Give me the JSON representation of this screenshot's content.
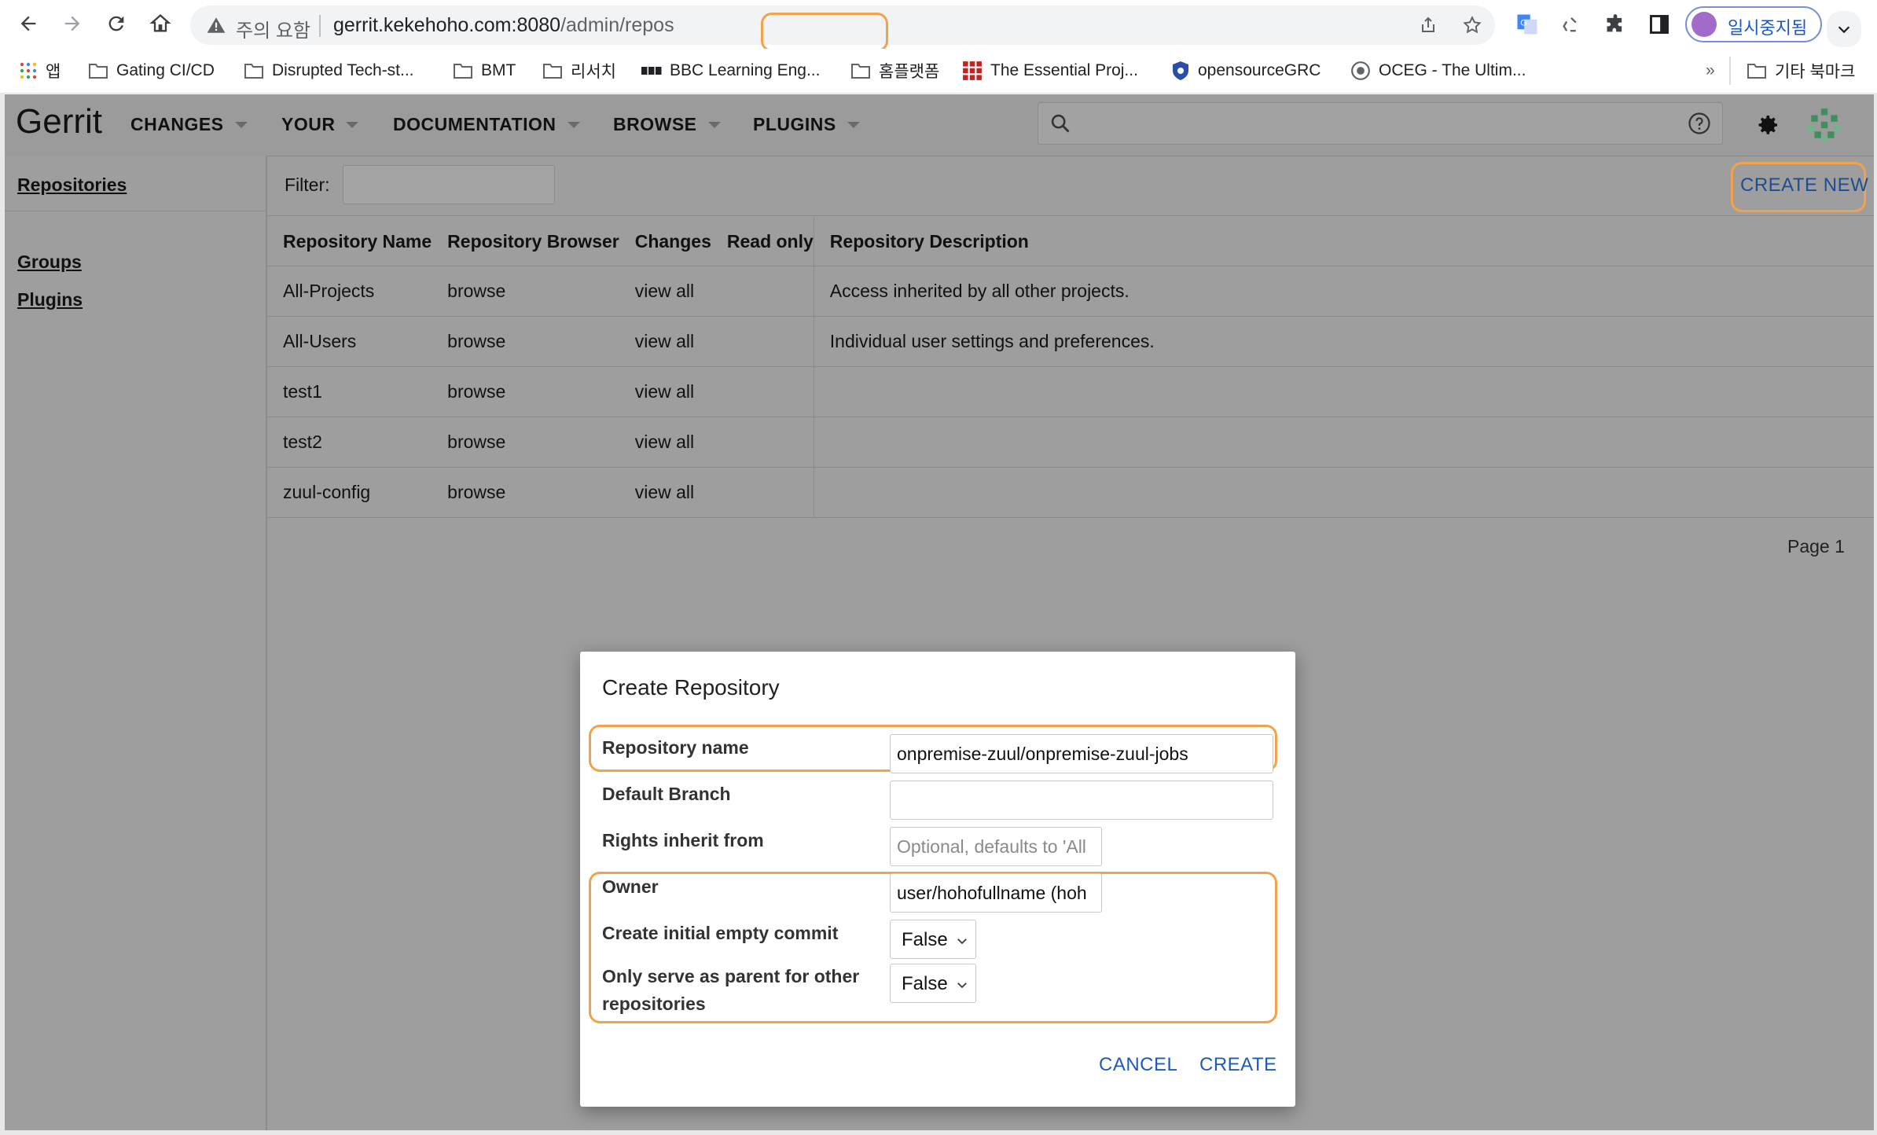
{
  "browser": {
    "security_label": "주의 요함",
    "url_host": "gerrit.kekehoho.com:8080",
    "url_path": "/admin/repos",
    "profile_label": "일시중지됨"
  },
  "bookmarks": {
    "apps": "앱",
    "items": [
      "Gating CI/CD",
      "Disrupted Tech-st...",
      "BMT",
      "리서치",
      "BBC Learning Eng...",
      "홈플랫폼",
      "The Essential Proj...",
      "opensourceGRC",
      "OCEG - The Ultim..."
    ],
    "overflow": "»",
    "other": "기타 북마크"
  },
  "gerrit": {
    "title": "Gerrit",
    "menus": [
      "CHANGES",
      "YOUR",
      "DOCUMENTATION",
      "BROWSE",
      "PLUGINS"
    ]
  },
  "sidebar": {
    "items": [
      "Repositories",
      "Groups",
      "Plugins"
    ]
  },
  "filter": {
    "label": "Filter:",
    "value": ""
  },
  "create_new": "CREATE NEW",
  "table": {
    "headers": [
      "Repository Name",
      "Repository Browser",
      "Changes",
      "Read only",
      "Repository Description"
    ],
    "rows": [
      {
        "name": "All-Projects",
        "browser": "browse",
        "changes": "view all",
        "readonly": "",
        "desc": "Access inherited by all other projects."
      },
      {
        "name": "All-Users",
        "browser": "browse",
        "changes": "view all",
        "readonly": "",
        "desc": "Individual user settings and preferences."
      },
      {
        "name": "test1",
        "browser": "browse",
        "changes": "view all",
        "readonly": "",
        "desc": ""
      },
      {
        "name": "test2",
        "browser": "browse",
        "changes": "view all",
        "readonly": "",
        "desc": ""
      },
      {
        "name": "zuul-config",
        "browser": "browse",
        "changes": "view all",
        "readonly": "",
        "desc": ""
      }
    ]
  },
  "page_info": "Page 1",
  "dialog": {
    "title": "Create Repository",
    "repo_name_label": "Repository name",
    "repo_name_value": "onpremise-zuul/onpremise-zuul-jobs",
    "default_branch_label": "Default Branch",
    "default_branch_value": "",
    "rights_label": "Rights inherit from",
    "rights_placeholder": "Optional, defaults to 'All",
    "owner_label": "Owner",
    "owner_value": "user/hohofullname (hoh",
    "initial_commit_label": "Create initial empty commit",
    "initial_commit_value": "False",
    "parent_only_label_1": "Only serve as parent for other",
    "parent_only_label_2": "repositories",
    "parent_only_value": "False",
    "cancel_label": "CANCEL",
    "create_label": "CREATE"
  },
  "colors": {
    "highlight": "#f2a24a",
    "link_blue": "#1d5bbf",
    "overlay_gray": "#9e9e9e"
  }
}
